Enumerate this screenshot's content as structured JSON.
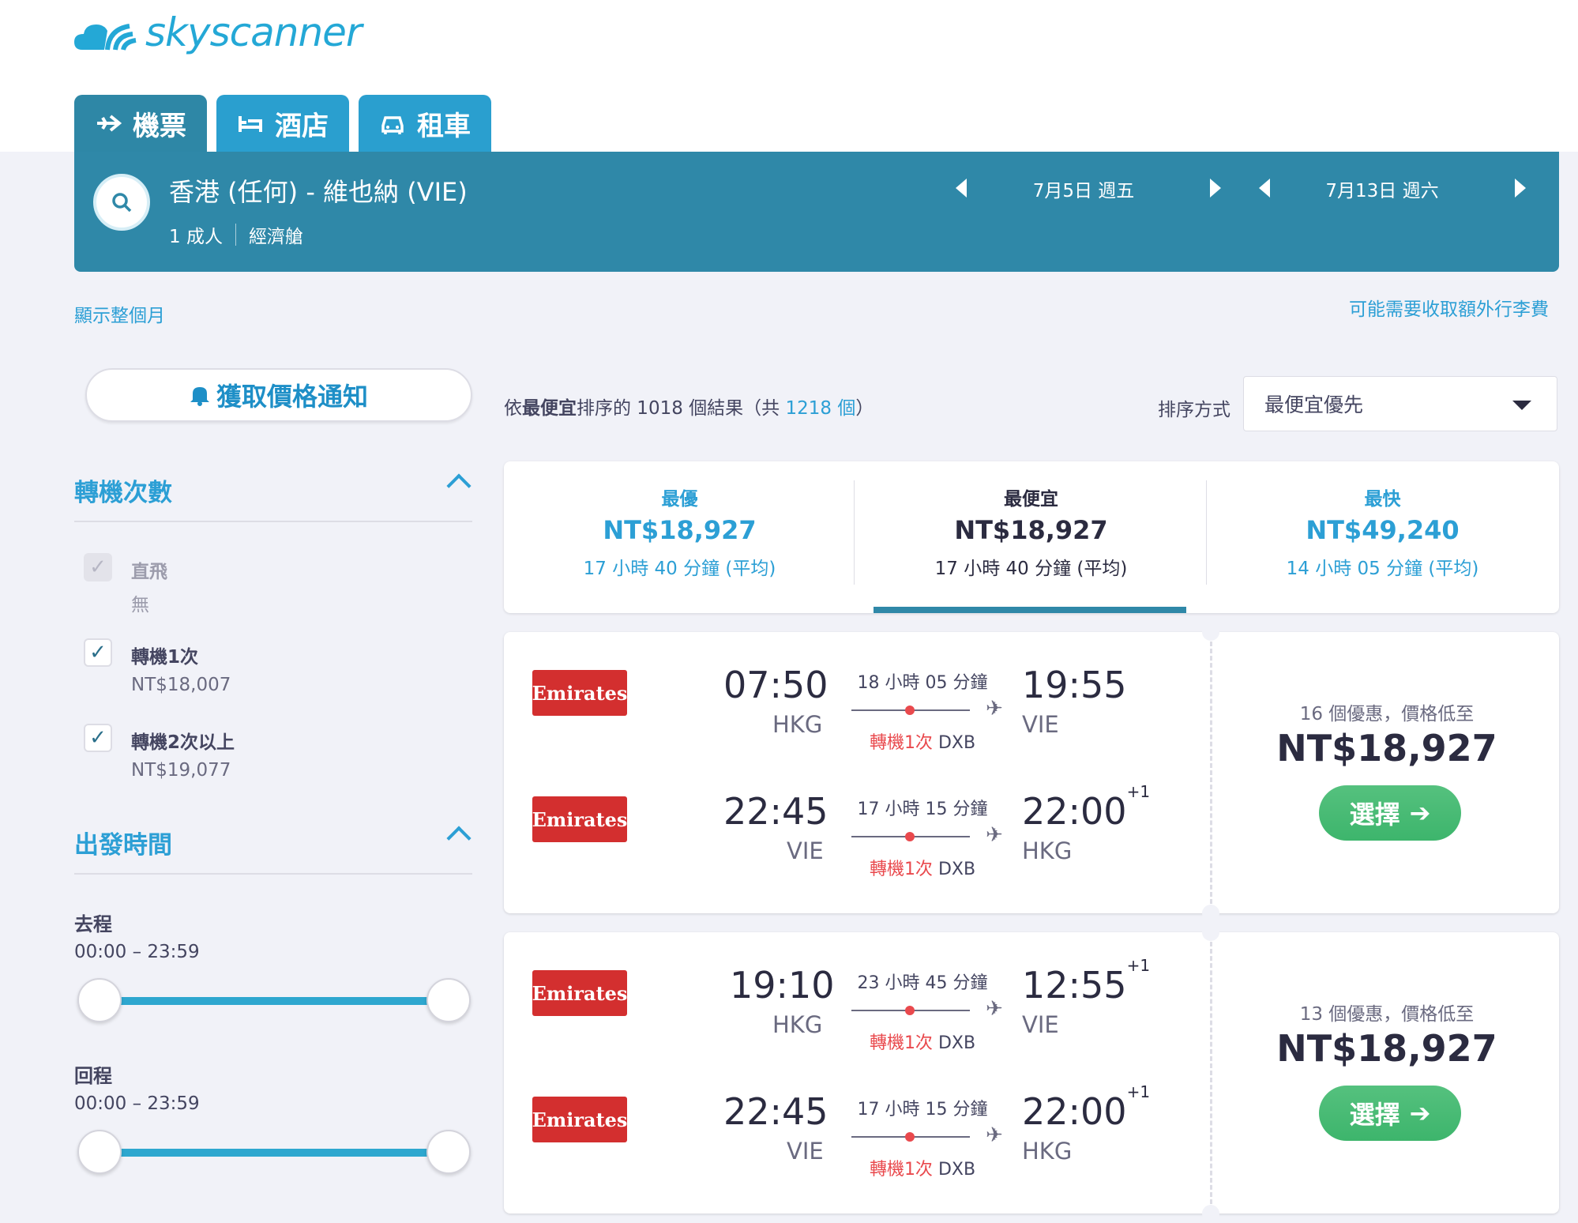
{
  "brand": {
    "name": "skyscanner",
    "color": "#24a8d6"
  },
  "tabs": [
    {
      "label": "機票",
      "icon": "plane-icon"
    },
    {
      "label": "酒店",
      "icon": "bed-icon"
    },
    {
      "label": "租車",
      "icon": "car-icon"
    }
  ],
  "search": {
    "route": "香港 (任何) - 維也納 (VIE)",
    "passengers": "1 成人",
    "cabin": "經濟艙",
    "depart_date": "7月5日 週五",
    "return_date": "7月13日 週六"
  },
  "links": {
    "show_month": "顯示整個月",
    "baggage_fee": "可能需要收取額外行李費"
  },
  "price_alert": {
    "label": "獲取價格通知"
  },
  "filters": {
    "stops": {
      "title": "轉機次數",
      "options": [
        {
          "label": "直飛",
          "price": "無",
          "checked": true,
          "disabled": true
        },
        {
          "label": "轉機1次",
          "price": "NT$18,007",
          "checked": true,
          "disabled": false
        },
        {
          "label": "轉機2次以上",
          "price": "NT$19,077",
          "checked": true,
          "disabled": false
        }
      ]
    },
    "departure_time": {
      "title": "出發時間",
      "outbound_label": "去程",
      "outbound_range": "00:00 – 23:59",
      "return_label": "回程",
      "return_range": "00:00 – 23:59"
    }
  },
  "results": {
    "prefix": "依",
    "sort_bold": "最便宜",
    "middle": "排序的 1018 個結果（共 ",
    "total": "1218 個",
    "suffix": "）"
  },
  "sort": {
    "label": "排序方式",
    "value": "最便宜優先"
  },
  "summary": [
    {
      "title": "最優",
      "price": "NT$18,927",
      "duration": "17 小時 40 分鐘 (平均)"
    },
    {
      "title": "最便宜",
      "price": "NT$18,927",
      "duration": "17 小時 40 分鐘 (平均)"
    },
    {
      "title": "最快",
      "price": "NT$49,240",
      "duration": "14 小時 05 分鐘 (平均)"
    }
  ],
  "itineraries": [
    {
      "legs": [
        {
          "airline": "Emirates",
          "dep_time": "07:50",
          "dep_code": "HKG",
          "duration": "18 小時 05 分鐘",
          "stops": "轉機1次",
          "via": "DXB",
          "arr_time": "19:55",
          "arr_day": "",
          "arr_code": "VIE"
        },
        {
          "airline": "Emirates",
          "dep_time": "22:45",
          "dep_code": "VIE",
          "duration": "17 小時 15 分鐘",
          "stops": "轉機1次",
          "via": "DXB",
          "arr_time": "22:00",
          "arr_day": "+1",
          "arr_code": "HKG"
        }
      ],
      "deals": "16 個優惠，價格低至",
      "price": "NT$18,927",
      "button": "選擇"
    },
    {
      "legs": [
        {
          "airline": "Emirates",
          "dep_time": "19:10",
          "dep_code": "HKG",
          "duration": "23 小時 45 分鐘",
          "stops": "轉機1次",
          "via": "DXB",
          "arr_time": "12:55",
          "arr_day": "+1",
          "arr_code": "VIE"
        },
        {
          "airline": "Emirates",
          "dep_time": "22:45",
          "dep_code": "VIE",
          "duration": "17 小時 15 分鐘",
          "stops": "轉機1次",
          "via": "DXB",
          "arr_time": "22:00",
          "arr_day": "+1",
          "arr_code": "HKG"
        }
      ],
      "deals": "13 個優惠，價格低至",
      "price": "NT$18,927",
      "button": "選擇"
    }
  ]
}
